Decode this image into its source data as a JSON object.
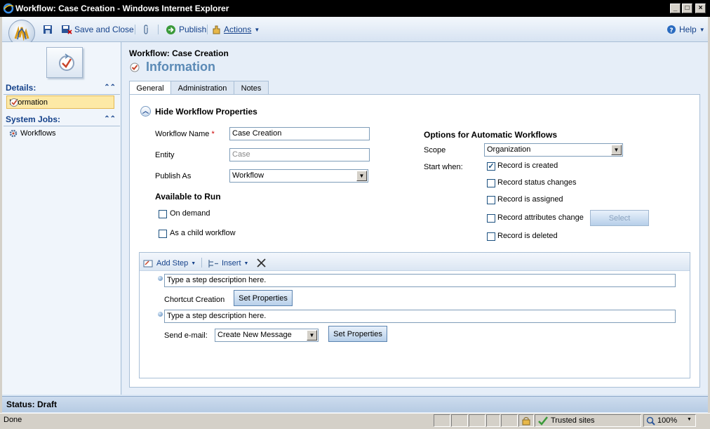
{
  "window": {
    "title": "Workflow: Case Creation - Windows Internet Explorer"
  },
  "toolbar": {
    "save_close": "Save and Close",
    "publish": "Publish",
    "actions": "Actions",
    "help": "Help"
  },
  "nav": {
    "details_header": "Details:",
    "information": "Information",
    "system_jobs_header": "System Jobs:",
    "workflows": "Workflows"
  },
  "header": {
    "subtitle": "Workflow: Case Creation",
    "title": "Information"
  },
  "tabs": [
    "General",
    "Administration",
    "Notes"
  ],
  "section": {
    "hide_label": "Hide Workflow Properties"
  },
  "form": {
    "workflow_name_label": "Workflow Name",
    "required_mark": "*",
    "workflow_name_value": "Case Creation",
    "entity_label": "Entity",
    "entity_value": "Case",
    "publish_as_label": "Publish As",
    "publish_as_value": "Workflow",
    "available_to_run": "Available to Run",
    "on_demand": "On demand",
    "child_workflow": "As a child workflow"
  },
  "auto": {
    "header": "Options for Automatic Workflows",
    "scope_label": "Scope",
    "scope_value": "Organization",
    "start_when_label": "Start when:",
    "options": [
      {
        "label": "Record is created",
        "checked": true
      },
      {
        "label": "Record status changes",
        "checked": false
      },
      {
        "label": "Record is assigned",
        "checked": false
      },
      {
        "label": "Record attributes change",
        "checked": false
      },
      {
        "label": "Record is deleted",
        "checked": false
      }
    ],
    "select_button": "Select"
  },
  "steps": {
    "add_step": "Add Step",
    "insert": "Insert",
    "step1_placeholder": "Type a step description here.",
    "step1_label": "Chortcut Creation",
    "step1_button": "Set Properties",
    "step2_placeholder": "Type a step description here.",
    "step2_label": "Send e-mail:",
    "step2_select": "Create New Message",
    "step2_button": "Set Properties"
  },
  "status": {
    "form_status": "Status: Draft",
    "ie_done": "Done",
    "zone": "Trusted sites",
    "zoom": "100%"
  },
  "colors": {
    "accent": "#15428b",
    "title_blue": "#5b8ab6",
    "frame": "#dbe7f5"
  }
}
